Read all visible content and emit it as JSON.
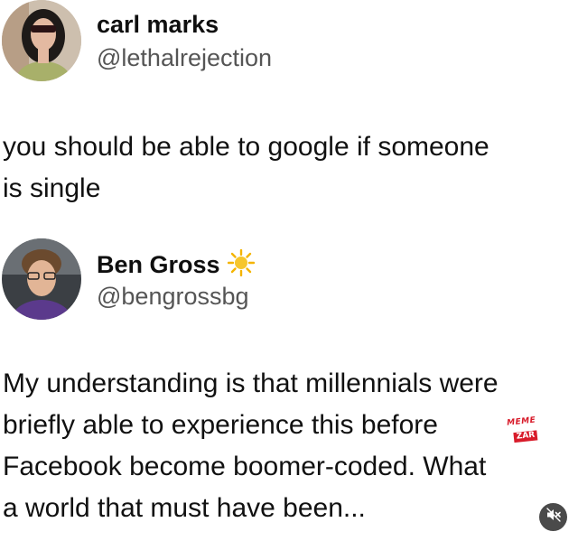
{
  "tweets": [
    {
      "author_name": "carl marks",
      "handle": "@lethalrejection",
      "text": "you should be able to google if someone\nis single"
    },
    {
      "author_name": "Ben Gross",
      "handle": "@bengrossbg",
      "name_emoji": "sun-icon",
      "text": "My understanding is that millennials were\nbriefly able to experience this before\nFacebook become boomer-coded. What\na world that must have been..."
    }
  ],
  "watermark": {
    "line1": "MEME",
    "line2": "ZAR"
  },
  "video_controls": {
    "mute_icon": "speaker-muted-icon"
  }
}
